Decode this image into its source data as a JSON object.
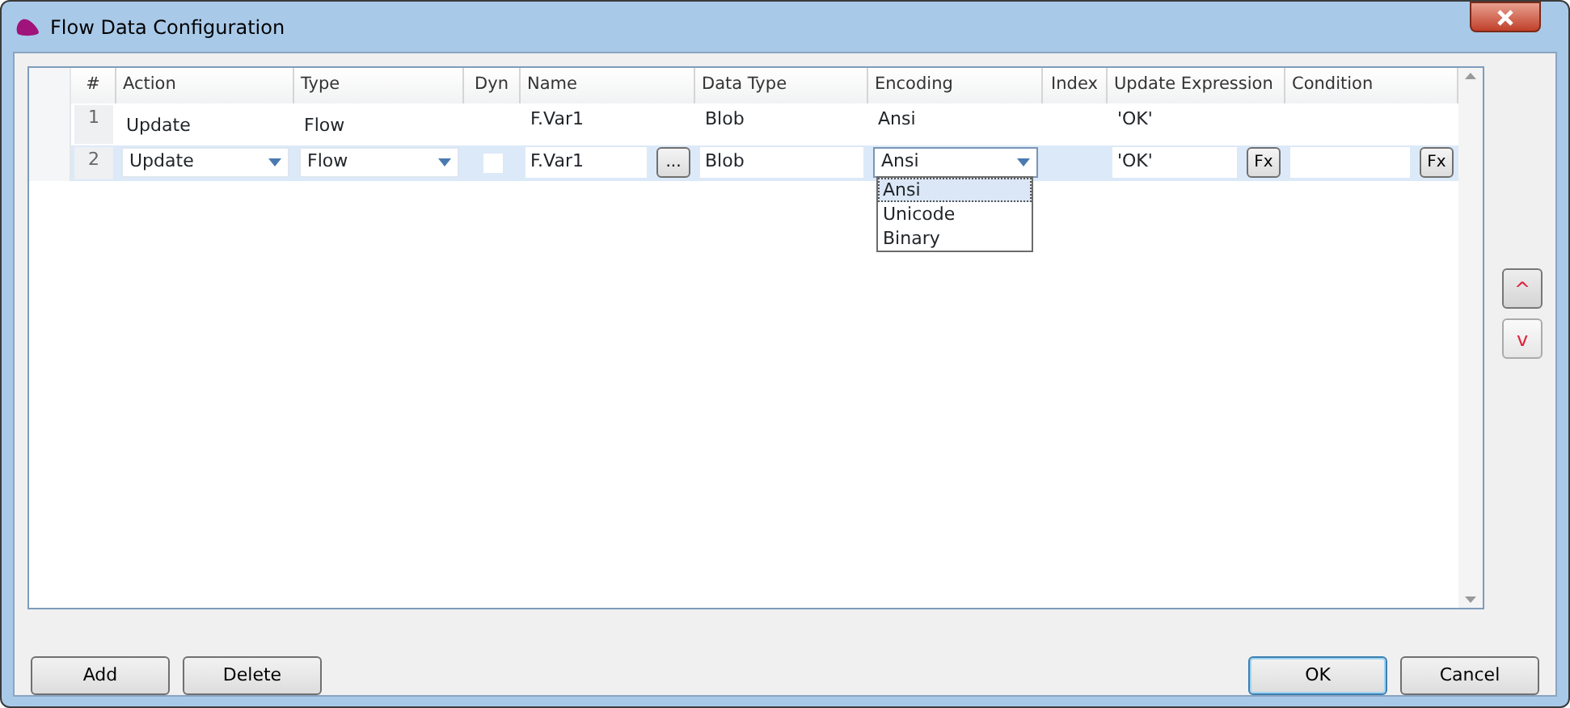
{
  "window": {
    "title": "Flow Data Configuration"
  },
  "columns": [
    "#",
    "Action",
    "Type",
    "Dyn",
    "Name",
    "Data Type",
    "Encoding",
    "Index",
    "Update Expression",
    "Condition"
  ],
  "rows": [
    {
      "selected": false,
      "cells": [
        {
          "kind": "num",
          "text": "1"
        },
        {
          "kind": "text",
          "text": "Update"
        },
        {
          "kind": "text",
          "text": "Flow"
        },
        {
          "kind": "empty"
        },
        {
          "kind": "text",
          "text": "F.Var1"
        },
        {
          "kind": "text",
          "text": "Blob"
        },
        {
          "kind": "text",
          "text": "Ansi"
        },
        {
          "kind": "empty"
        },
        {
          "kind": "text",
          "text": "'OK'"
        },
        {
          "kind": "empty"
        }
      ]
    },
    {
      "selected": true,
      "cells": [
        {
          "kind": "num",
          "text": "2"
        },
        {
          "kind": "combo",
          "text": "Update"
        },
        {
          "kind": "combo",
          "text": "Flow"
        },
        {
          "kind": "check",
          "checked": false
        },
        {
          "kind": "textbutton",
          "text": "F.Var1",
          "button": "..."
        },
        {
          "kind": "field",
          "text": "Blob"
        },
        {
          "kind": "combo",
          "text": "Ansi",
          "expanded": true,
          "options": [
            {
              "label": "Ansi",
              "selected": true
            },
            {
              "label": "Unicode",
              "selected": false
            },
            {
              "label": "Binary",
              "selected": false
            }
          ]
        },
        {
          "kind": "empty"
        },
        {
          "kind": "textbutton",
          "text": "'OK'",
          "button": "Fx"
        },
        {
          "kind": "textbutton",
          "text": "",
          "button": "Fx"
        }
      ]
    }
  ],
  "move_buttons": [
    "^",
    "v"
  ],
  "left_buttons": [
    "Add",
    "Delete"
  ],
  "right_buttons": [
    {
      "label": "OK",
      "default": true
    },
    {
      "label": "Cancel",
      "default": false
    }
  ]
}
